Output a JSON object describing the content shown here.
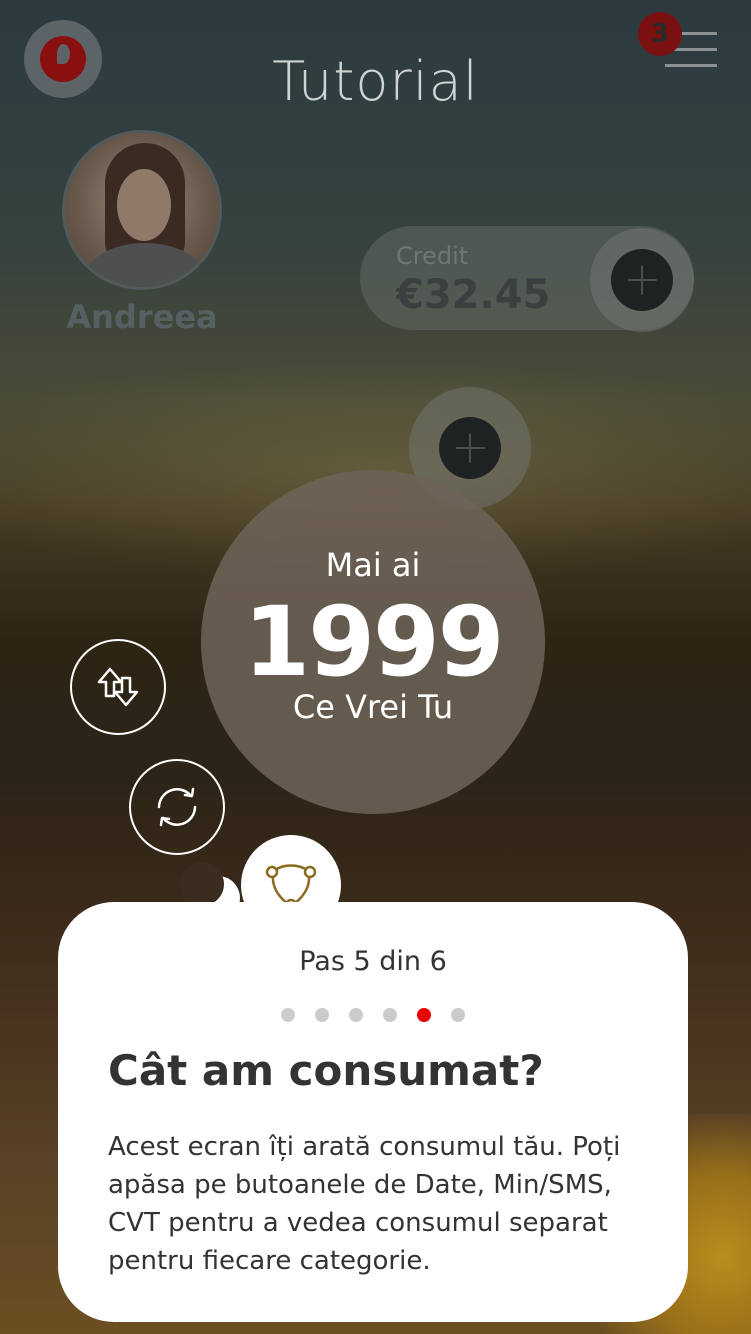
{
  "header": {
    "title": "Tutorial",
    "notification_count": "3",
    "logo_icon": "vodafone-logo-icon",
    "menu_icon": "hamburger-menu-icon"
  },
  "profile": {
    "name": "Andreea"
  },
  "credit": {
    "label": "Credit",
    "value": "€32.45",
    "add_icon": "plus-icon"
  },
  "summary": {
    "prefix": "Mai ai",
    "value": "1999",
    "suffix": "Ce Vrei Tu"
  },
  "actions": {
    "transfer_icon": "arrows-up-down-icon",
    "refresh_icon": "refresh-icon",
    "add_icon": "plus-icon"
  },
  "tutorial": {
    "step_text": "Pas 5 din 6",
    "total_steps": 6,
    "current_step": 5,
    "heading": "Cât am consumat?",
    "body": "Acest ecran îți arată consumul tău. Poți apăsa pe butoanele de Date, Min/SMS, CVT pentru a vedea consumul separat pentru fiecare categorie.",
    "icon": "network-nodes-icon"
  },
  "colors": {
    "accent_red": "#e60000",
    "inactive_dot": "#cccccc"
  }
}
